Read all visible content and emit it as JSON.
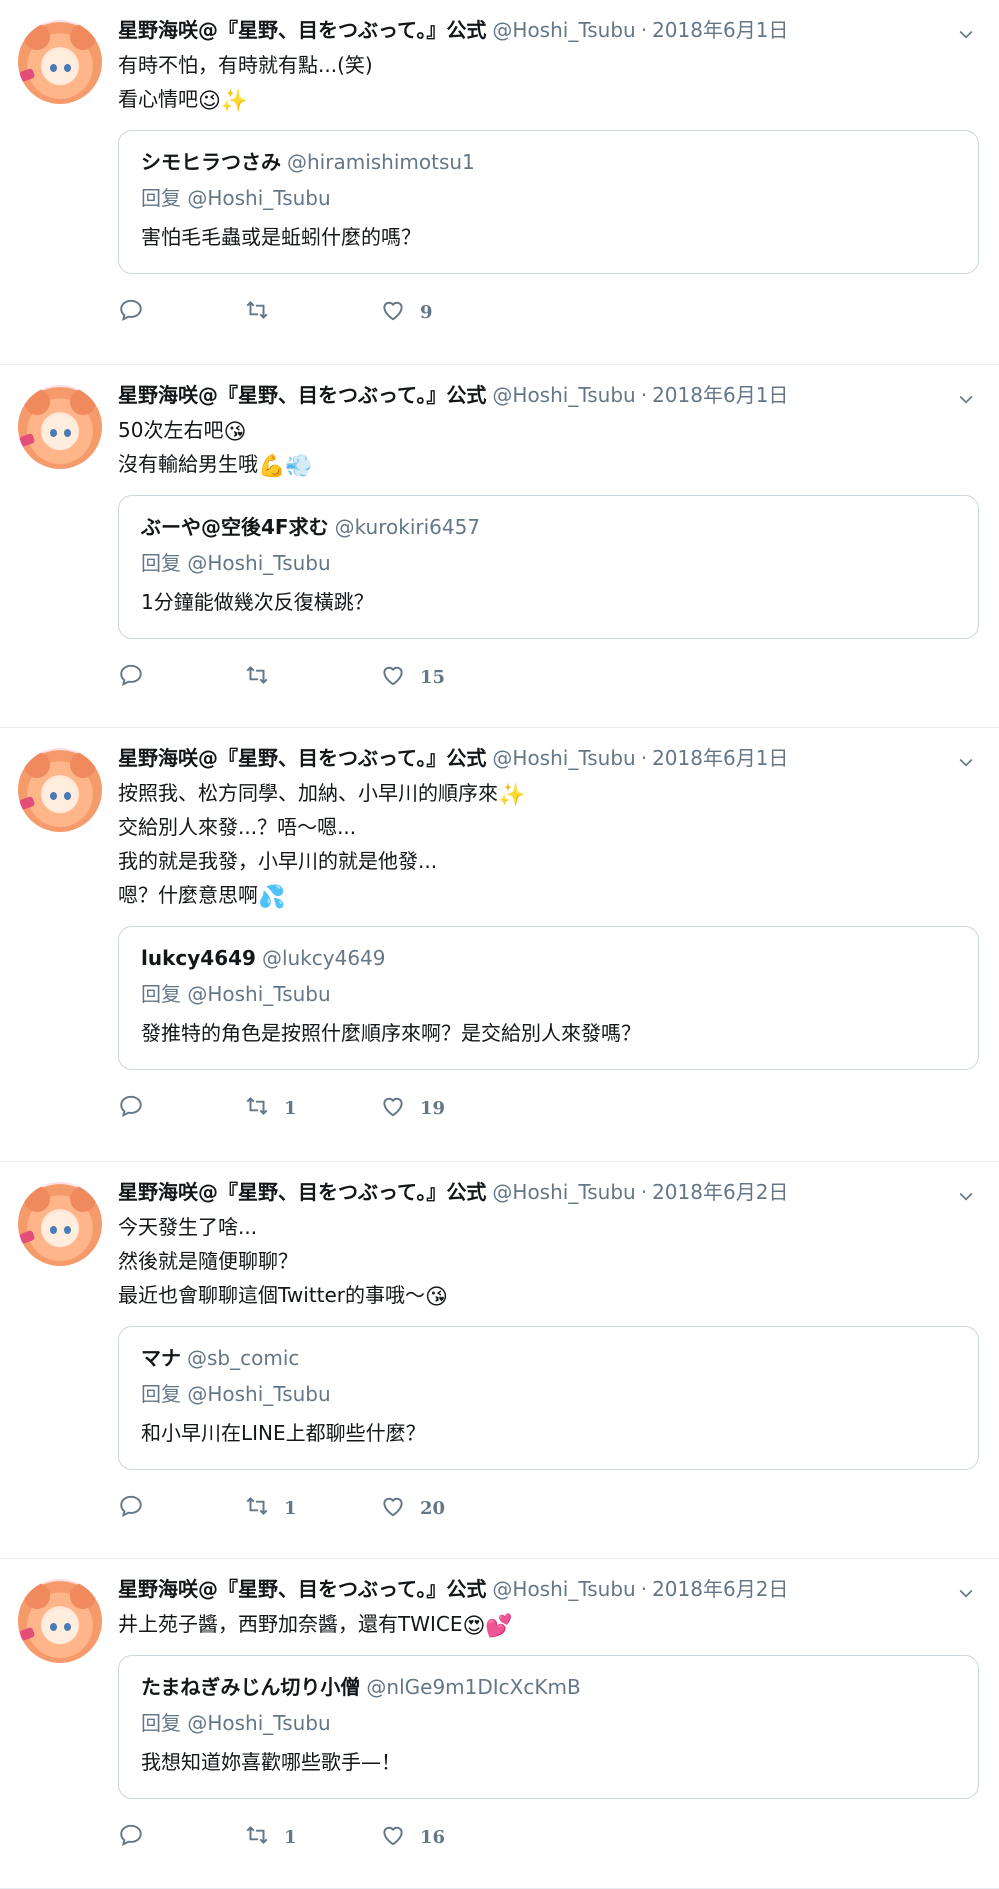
{
  "account": {
    "name": "星野海咲@『星野、目をつぶって。』公式",
    "handle": "@Hoshi_Tsubu",
    "separator": "·"
  },
  "reply_prefix": "回复",
  "icons": {
    "reply": "reply-icon",
    "retweet": "retweet-icon",
    "like": "heart-icon",
    "more": "chevron-down-icon"
  },
  "tweets": [
    {
      "date": "2018年6月1日",
      "lines": [
        "有時不怕，有時就有點...(笑)",
        "看心情吧"
      ],
      "line_emoji": [
        "",
        "😉✨"
      ],
      "quote": {
        "name": "シモヒラつさみ",
        "handle": "@hiramishimotsu1",
        "reply_to": "@Hoshi_Tsubu",
        "text": "害怕毛毛蟲或是蚯蚓什麼的嗎？"
      },
      "retweets": "",
      "likes": "9"
    },
    {
      "date": "2018年6月1日",
      "lines": [
        "50次左右吧",
        "沒有輸給男生哦"
      ],
      "line_emoji": [
        "😘",
        "💪💨"
      ],
      "quote": {
        "name": "ぶーや@空後4F求む",
        "handle": "@kurokiri6457",
        "reply_to": "@Hoshi_Tsubu",
        "text": "1分鐘能做幾次反復橫跳？"
      },
      "retweets": "",
      "likes": "15"
    },
    {
      "date": "2018年6月1日",
      "lines": [
        "按照我、松方同學、加納、小早川的順序來",
        "交給別人來發...？唔～嗯...",
        "我的就是我發，小早川的就是他發...",
        "嗯？什麼意思啊"
      ],
      "line_emoji": [
        "✨",
        "",
        "",
        "💦"
      ],
      "quote": {
        "name": "lukcy4649",
        "handle": "@lukcy4649",
        "reply_to": "@Hoshi_Tsubu",
        "text": "發推特的角色是按照什麼順序來啊？是交給別人來發嗎？"
      },
      "retweets": "1",
      "likes": "19"
    },
    {
      "date": "2018年6月2日",
      "lines": [
        "今天發生了啥...",
        "然後就是隨便聊聊？",
        "最近也會聊聊這個Twitter的事哦～"
      ],
      "line_emoji": [
        "",
        "",
        "😘"
      ],
      "quote": {
        "name": "マナ",
        "handle": "@sb_comic",
        "reply_to": "@Hoshi_Tsubu",
        "text": "和小早川在LINE上都聊些什麼？"
      },
      "retweets": "1",
      "likes": "20"
    },
    {
      "date": "2018年6月2日",
      "lines": [
        "井上苑子醬，西野加奈醬，還有TWICE"
      ],
      "line_emoji": [
        "😍💕"
      ],
      "quote": {
        "name": "たまねぎみじん切り小僧",
        "handle": "@nlGe9m1DIcXcKmB",
        "reply_to": "@Hoshi_Tsubu",
        "text": "我想知道妳喜歡哪些歌手—！"
      },
      "retweets": "1",
      "likes": "16"
    }
  ]
}
